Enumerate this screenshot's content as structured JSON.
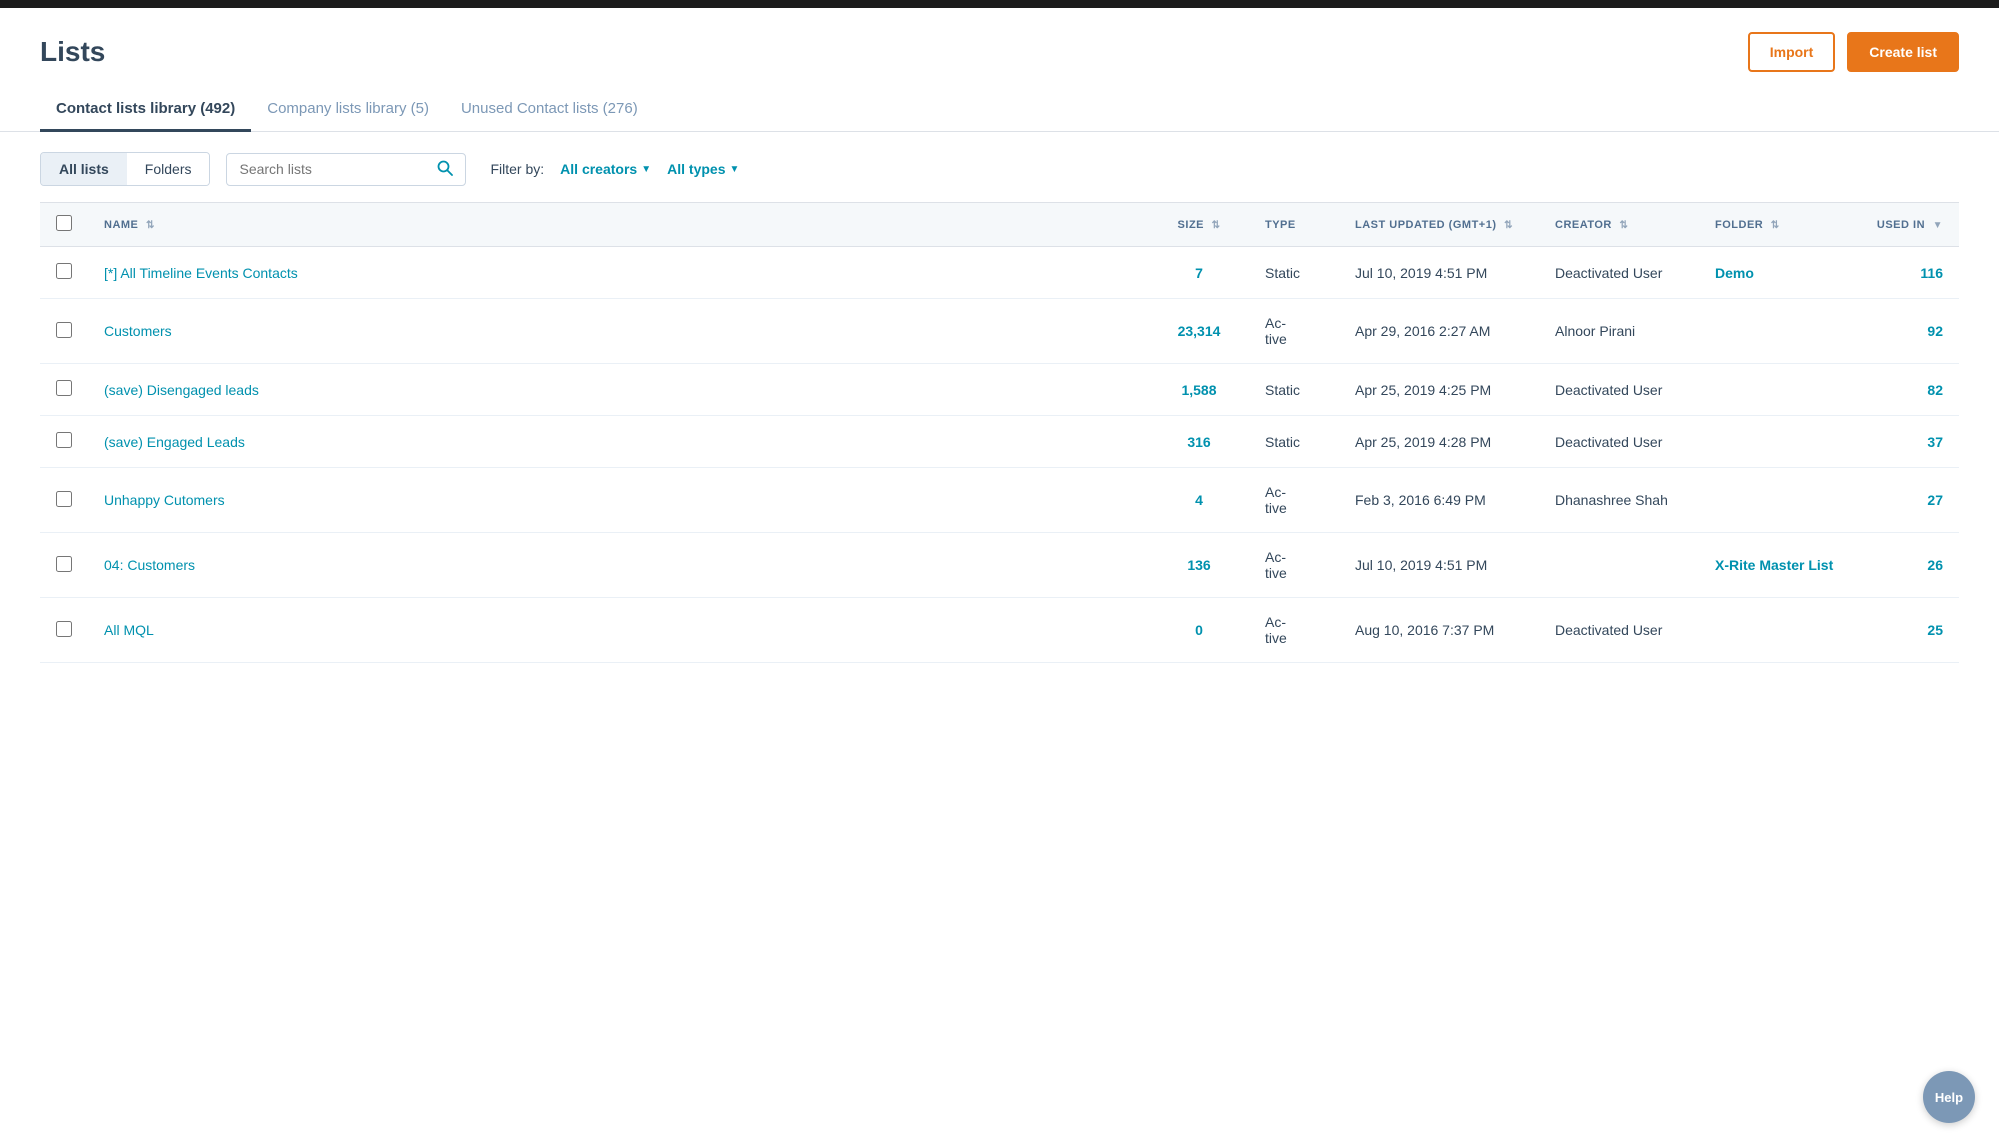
{
  "topbar": {},
  "header": {
    "title": "Lists",
    "import_label": "Import",
    "create_label": "Create list"
  },
  "tabs": [
    {
      "id": "contact",
      "label": "Contact lists library (492)",
      "active": true
    },
    {
      "id": "company",
      "label": "Company lists library (5)",
      "active": false
    },
    {
      "id": "unused",
      "label": "Unused Contact lists (276)",
      "active": false
    }
  ],
  "toolbar": {
    "toggle_all": "All lists",
    "toggle_folders": "Folders",
    "search_placeholder": "Search lists",
    "filter_label": "Filter by:",
    "all_creators": "All creators",
    "all_types": "All types"
  },
  "table": {
    "columns": [
      {
        "id": "name",
        "label": "NAME",
        "sortable": true
      },
      {
        "id": "size",
        "label": "SIZE",
        "sortable": true
      },
      {
        "id": "type",
        "label": "TYPE",
        "sortable": false
      },
      {
        "id": "updated",
        "label": "LAST UPDATED (GMT+1)",
        "sortable": true
      },
      {
        "id": "creator",
        "label": "CREATOR",
        "sortable": true
      },
      {
        "id": "folder",
        "label": "FOLDER",
        "sortable": true
      },
      {
        "id": "used_in",
        "label": "USED IN",
        "sortable": true
      }
    ],
    "rows": [
      {
        "name": "[*] All Timeline Events Contacts",
        "size": "7",
        "type": "Static",
        "updated": "Jul 10, 2019 4:51 PM",
        "creator": "Deactivated User",
        "folder": "Demo",
        "folder_link": true,
        "used_in": "116"
      },
      {
        "name": "Customers",
        "size": "23,314",
        "type": "Ac-\ntive",
        "updated": "Apr 29, 2016 2:27 AM",
        "creator": "Alnoor Pirani",
        "folder": "",
        "folder_link": false,
        "used_in": "92"
      },
      {
        "name": "(save) Disengaged leads",
        "size": "1,588",
        "type": "Static",
        "updated": "Apr 25, 2019 4:25 PM",
        "creator": "Deactivated User",
        "folder": "",
        "folder_link": false,
        "used_in": "82"
      },
      {
        "name": "(save) Engaged Leads",
        "size": "316",
        "type": "Static",
        "updated": "Apr 25, 2019 4:28 PM",
        "creator": "Deactivated User",
        "folder": "",
        "folder_link": false,
        "used_in": "37"
      },
      {
        "name": "Unhappy Cutomers",
        "size": "4",
        "type": "Ac-\ntive",
        "updated": "Feb 3, 2016 6:49 PM",
        "creator": "Dhanashree Shah",
        "folder": "",
        "folder_link": false,
        "used_in": "27"
      },
      {
        "name": "04: Customers",
        "size": "136",
        "type": "Ac-\ntive",
        "updated": "Jul 10, 2019 4:51 PM",
        "creator": "",
        "folder": "X-Rite Master List",
        "folder_link": true,
        "used_in": "26"
      },
      {
        "name": "All MQL",
        "size": "0",
        "type": "Ac-\ntive",
        "updated": "Aug 10, 2016 7:37 PM",
        "creator": "Deactivated User",
        "folder": "",
        "folder_link": false,
        "used_in": "25"
      }
    ]
  },
  "help": {
    "label": "Help"
  }
}
